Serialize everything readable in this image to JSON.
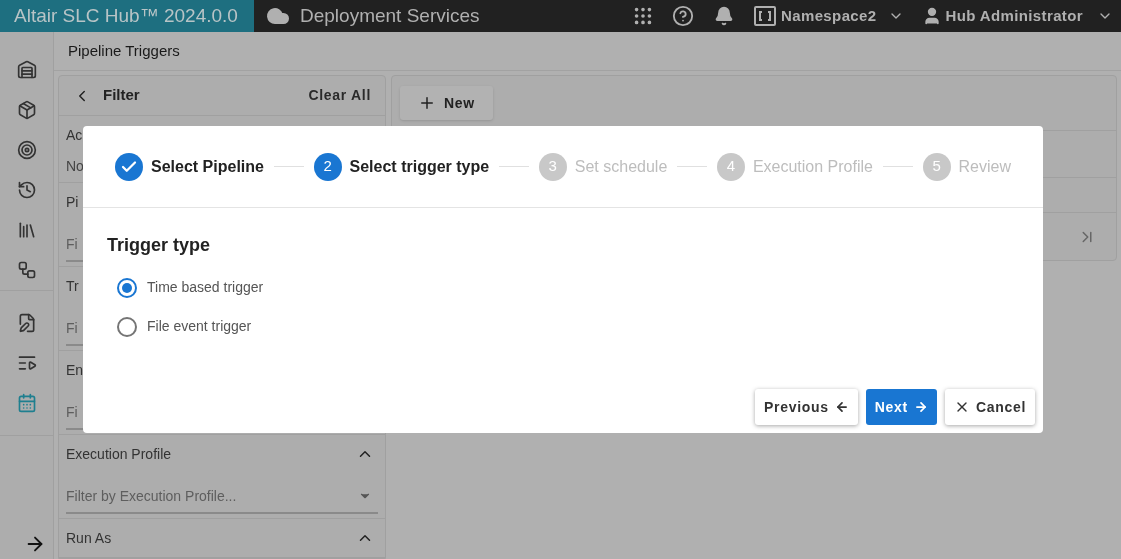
{
  "header": {
    "brand": "Altair SLC Hub™ 2024.0.0",
    "app_title": "Deployment Services",
    "namespace": "Namespace2",
    "user": "Hub Administrator"
  },
  "sidebar": {
    "items": [
      {
        "selected": false
      },
      {
        "selected": false
      },
      {
        "selected": false
      },
      {
        "selected": false
      },
      {
        "selected": false
      },
      {
        "selected": false
      },
      {
        "selected": false
      },
      {
        "selected": false
      },
      {
        "selected": true
      }
    ]
  },
  "page_title": "Pipeline Triggers",
  "filter": {
    "title": "Filter",
    "clear": "Clear All",
    "sections": [
      {
        "kind": "text",
        "label": "Ac",
        "value": "No"
      },
      {
        "kind": "field",
        "label": "Pi",
        "placeholder": "Fi"
      },
      {
        "kind": "field",
        "label": "Tr",
        "placeholder": "Fi"
      },
      {
        "kind": "field",
        "label": "En",
        "placeholder": "Fi"
      },
      {
        "kind": "field",
        "label": "Execution Profile",
        "placeholder": "Filter by Execution Profile...",
        "expanded": true
      },
      {
        "kind": "header",
        "label": "Run As",
        "expanded": true
      }
    ]
  },
  "new_button": "New",
  "dialog": {
    "steps": [
      {
        "label": "Select Pipeline",
        "completed": true
      },
      {
        "number": "2",
        "label": "Select trigger type",
        "completed": false,
        "selected": true
      },
      {
        "number": "3",
        "label": "Set schedule",
        "completed": false,
        "selected": false
      },
      {
        "number": "4",
        "label": "Execution Profile",
        "completed": false,
        "selected": false
      },
      {
        "number": "5",
        "label": "Review",
        "completed": false,
        "selected": false
      }
    ],
    "heading": "Trigger type",
    "options": [
      {
        "label": "Time based trigger",
        "selected": true
      },
      {
        "label": "File event trigger",
        "selected": false
      }
    ],
    "buttons": [
      {
        "kind": "previous",
        "label": "Previous"
      },
      {
        "kind": "next",
        "label": "Next"
      },
      {
        "kind": "cancel",
        "label": "Cancel"
      }
    ]
  }
}
